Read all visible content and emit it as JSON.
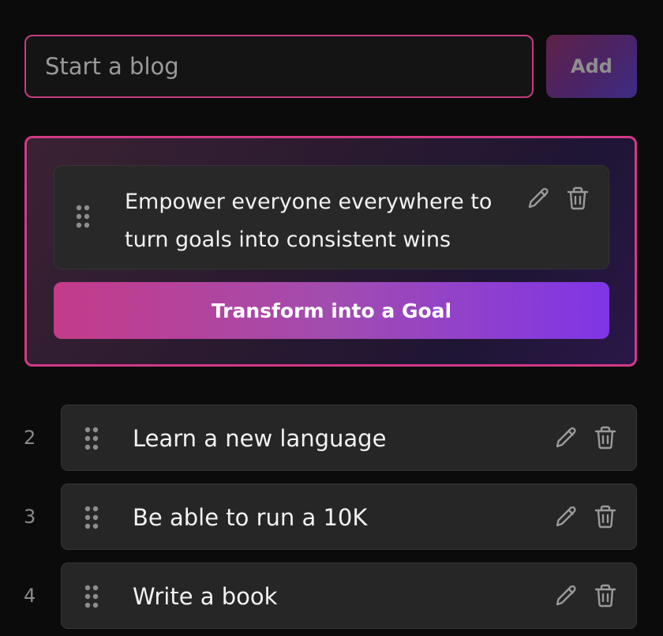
{
  "new_goal": {
    "placeholder": "Start a blog",
    "add_label": "Add"
  },
  "featured": {
    "text": "Empower everyone everywhere to turn goals into consistent wins",
    "transform_label": "Transform into a Goal"
  },
  "goals": [
    {
      "number": "2",
      "label": "Learn a new language"
    },
    {
      "number": "3",
      "label": "Be able to run a 10K"
    },
    {
      "number": "4",
      "label": "Write a book"
    }
  ],
  "icons": {
    "drag": "drag-handle-icon",
    "edit": "pencil-icon",
    "delete": "trash-icon"
  },
  "colors": {
    "background": "#0b0b0b",
    "accent_pink": "#c43b82",
    "accent_purple": "#7f35e6",
    "card": "#262626"
  }
}
